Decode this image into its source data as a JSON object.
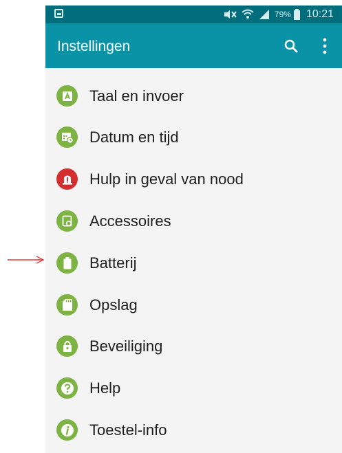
{
  "status_bar": {
    "battery_percent": "79%",
    "time": "10:21",
    "icons": [
      "image-notification-icon",
      "mute-icon",
      "wifi-icon",
      "signal-icon",
      "battery-icon"
    ]
  },
  "toolbar": {
    "title": "Instellingen",
    "search_icon": "search-icon",
    "more_icon": "more-vert-icon"
  },
  "settings_items": [
    {
      "label": "Taal en invoer",
      "icon": "language-input-icon",
      "color": "#7cb342"
    },
    {
      "label": "Datum en tijd",
      "icon": "calendar-clock-icon",
      "color": "#7cb342"
    },
    {
      "label": "Hulp in geval van nood",
      "icon": "emergency-icon",
      "color": "#d32f2f"
    },
    {
      "label": "Accessoires",
      "icon": "accessory-icon",
      "color": "#7cb342"
    },
    {
      "label": "Batterij",
      "icon": "battery-icon",
      "color": "#7cb342"
    },
    {
      "label": "Opslag",
      "icon": "sd-card-icon",
      "color": "#7cb342"
    },
    {
      "label": "Beveiliging",
      "icon": "lock-icon",
      "color": "#7cb342"
    },
    {
      "label": "Help",
      "icon": "help-icon",
      "color": "#7cb342"
    },
    {
      "label": "Toestel-info",
      "icon": "info-icon",
      "color": "#7cb342"
    }
  ],
  "colors": {
    "status_bar": "#006d7c",
    "toolbar": "#0a93a7",
    "list_background": "#f4f4f4",
    "annotation_arrow": "#e53935"
  }
}
